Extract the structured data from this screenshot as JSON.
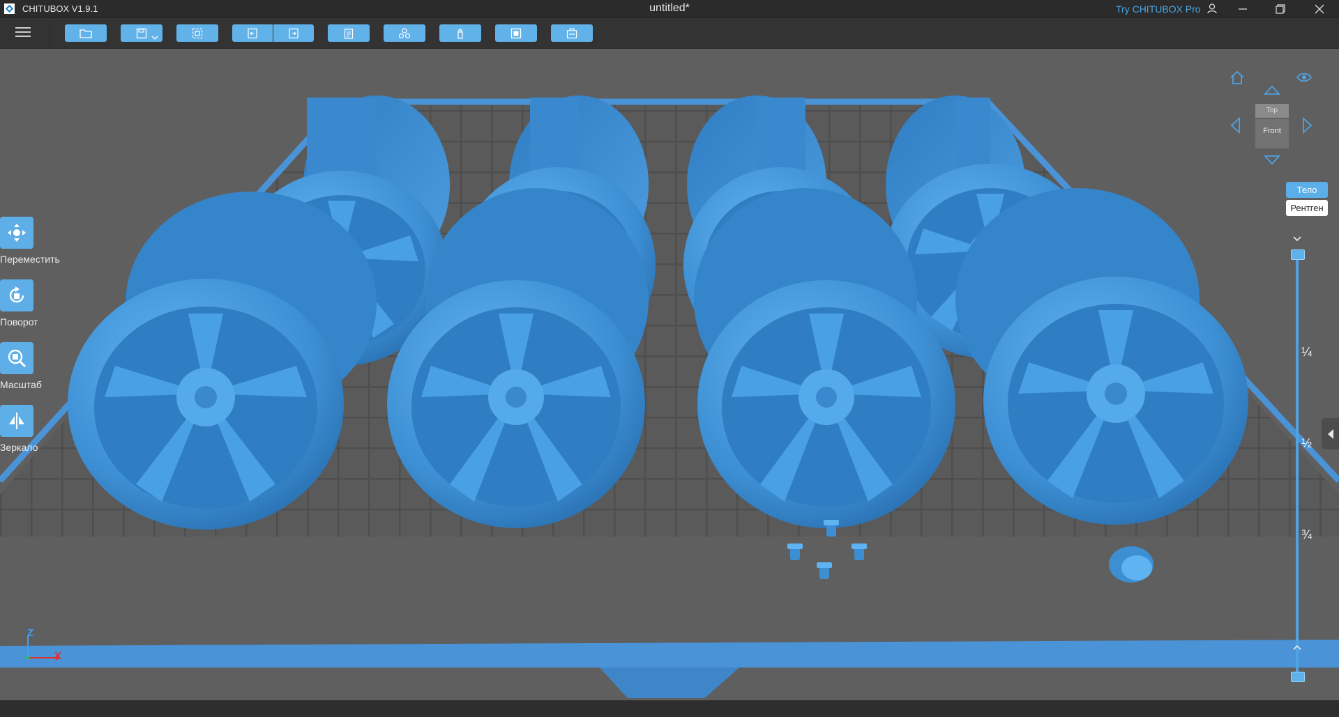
{
  "app": {
    "name": "CHITUBOX V1.9.1",
    "document_title": "untitled*",
    "pro_link": "Try CHITUBOX Pro",
    "accent_color": "#5caee8"
  },
  "window_controls": [
    "user-icon",
    "minimize-icon",
    "maximize-icon",
    "close-icon"
  ],
  "toolbar": {
    "buttons": [
      {
        "name": "open-file-button",
        "icon": "folder-icon"
      },
      {
        "name": "save-button",
        "icon": "save-icon",
        "has_dropdown": true
      },
      {
        "name": "select-all-button",
        "icon": "select-all-icon"
      },
      {
        "name": "undo-button",
        "icon": "undo-icon"
      },
      {
        "name": "redo-button",
        "icon": "redo-icon"
      },
      {
        "name": "clipboard-button",
        "icon": "clipboard-icon"
      },
      {
        "name": "arrange-button",
        "icon": "arrange-icon"
      },
      {
        "name": "support-button",
        "icon": "support-icon"
      },
      {
        "name": "hollow-button",
        "icon": "hollow-icon"
      },
      {
        "name": "slice-button",
        "icon": "slice-icon"
      }
    ]
  },
  "left_tools": [
    {
      "id": "move",
      "label": "Переместить",
      "icon": "move-icon"
    },
    {
      "id": "rotate",
      "label": "Поворот",
      "icon": "rotate-icon"
    },
    {
      "id": "scale",
      "label": "Масштаб",
      "icon": "scale-icon"
    },
    {
      "id": "mirror",
      "label": "Зеркало",
      "icon": "mirror-icon"
    }
  ],
  "view_cube": {
    "top": "Top",
    "front": "Front"
  },
  "view_modes": {
    "body": "Тело",
    "xray": "Рентген",
    "selected": "body"
  },
  "layer_slider": {
    "marks": [
      "¼",
      "½",
      "¾"
    ],
    "upper_value": 1.0,
    "lower_value": 0.0
  },
  "axes": {
    "z": "Z",
    "x": "X"
  },
  "scene": {
    "objects": [
      "wheel-rim",
      "wheel-rim",
      "wheel-rim",
      "wheel-rim",
      "wheel-rim",
      "wheel-rim",
      "wheel-rim",
      "wheel-rim",
      "lug-nut",
      "lug-nut",
      "lug-nut",
      "lug-nut",
      "center-cap"
    ],
    "model_color": "#3d8fd4",
    "plate_color": "#4a93d6"
  }
}
